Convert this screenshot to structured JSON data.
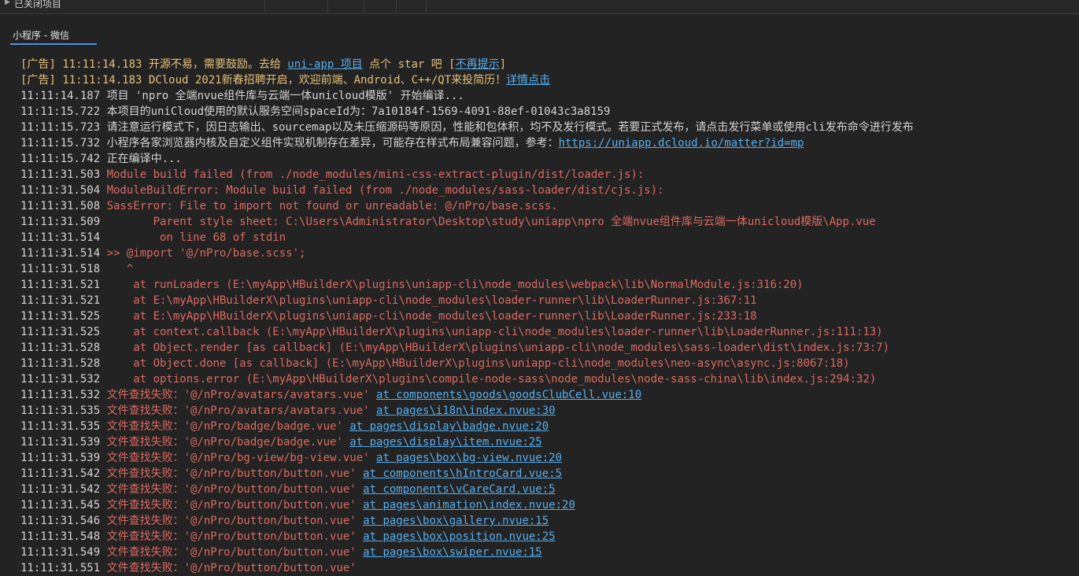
{
  "topbar": {
    "closed_projects_label": "已关闭项目"
  },
  "console": {
    "tab_label": "小程序 - 微信",
    "lines": [
      {
        "type": "ad",
        "segments": [
          {
            "text": "[广告] 11:11:14.183 开源不易，需要鼓励。去给 ",
            "kind": "ad"
          },
          {
            "text": "uni-app 项目",
            "kind": "link"
          },
          {
            "text": " 点个 star 吧 [",
            "kind": "ad"
          },
          {
            "text": "不再提示",
            "kind": "link"
          },
          {
            "text": "]",
            "kind": "ad"
          }
        ]
      },
      {
        "type": "ad",
        "segments": [
          {
            "text": "[广告] 11:11:14.183 DCloud 2021新春招聘开启，欢迎前端、Android、C++/QT来投简历！",
            "kind": "ad"
          },
          {
            "text": "详情点击",
            "kind": "link"
          }
        ]
      },
      {
        "type": "info",
        "segments": [
          {
            "text": "11:11:14.187 ",
            "kind": "ts"
          },
          {
            "text": "项目 'npro 全端nvue组件库与云端一体unicloud模版' 开始编译...",
            "kind": "info"
          }
        ]
      },
      {
        "type": "info",
        "segments": [
          {
            "text": "11:11:15.722 ",
            "kind": "ts"
          },
          {
            "text": "本项目的uniCloud使用的默认服务空间spaceId为：7a10184f-1569-4091-88ef-01043c3a8159",
            "kind": "info"
          }
        ]
      },
      {
        "type": "info",
        "segments": [
          {
            "text": "11:11:15.723 ",
            "kind": "ts"
          },
          {
            "text": "请注意运行模式下，因日志输出、sourcemap以及未压缩源码等原因，性能和包体积，均不及发行模式。若要正式发布，请点击发行菜单或使用cli发布命令进行发布",
            "kind": "info"
          }
        ]
      },
      {
        "type": "info",
        "segments": [
          {
            "text": "11:11:15.732 ",
            "kind": "ts"
          },
          {
            "text": "小程序各家浏览器内核及自定义组件实现机制存在差异，可能存在样式布局兼容问题，参考：",
            "kind": "info"
          },
          {
            "text": "https://uniapp.dcloud.io/matter?id=mp",
            "kind": "link"
          }
        ]
      },
      {
        "type": "info",
        "segments": [
          {
            "text": "11:11:15.742 ",
            "kind": "ts"
          },
          {
            "text": "正在编译中...",
            "kind": "info"
          }
        ]
      },
      {
        "type": "err",
        "segments": [
          {
            "text": "11:11:31.503 ",
            "kind": "ts"
          },
          {
            "text": "Module build failed (from ./node_modules/mini-css-extract-plugin/dist/loader.js):",
            "kind": "err"
          }
        ]
      },
      {
        "type": "err",
        "segments": [
          {
            "text": "11:11:31.504 ",
            "kind": "ts"
          },
          {
            "text": "ModuleBuildError: Module build failed (from ./node_modules/sass-loader/dist/cjs.js):",
            "kind": "err"
          }
        ]
      },
      {
        "type": "err",
        "segments": [
          {
            "text": "11:11:31.508 ",
            "kind": "ts"
          },
          {
            "text": "SassError: File to import not found or unreadable: @/nPro/base.scss.",
            "kind": "err"
          }
        ]
      },
      {
        "type": "err",
        "segments": [
          {
            "text": "11:11:31.509 ",
            "kind": "ts"
          },
          {
            "text": "       Parent style sheet: C:\\Users\\Administrator\\Desktop\\study\\uniapp\\npro 全端nvue组件库与云端一体unicloud模版\\App.vue",
            "kind": "err"
          }
        ]
      },
      {
        "type": "err",
        "segments": [
          {
            "text": "11:11:31.514 ",
            "kind": "ts"
          },
          {
            "text": "        on line 68 of stdin",
            "kind": "err"
          }
        ]
      },
      {
        "type": "err",
        "segments": [
          {
            "text": "11:11:31.514 ",
            "kind": "ts"
          },
          {
            "text": ">> @import '@/nPro/base.scss';",
            "kind": "err"
          }
        ]
      },
      {
        "type": "err",
        "segments": [
          {
            "text": "11:11:31.518 ",
            "kind": "ts"
          },
          {
            "text": "   ^",
            "kind": "err"
          }
        ]
      },
      {
        "type": "err",
        "segments": [
          {
            "text": "11:11:31.521 ",
            "kind": "ts"
          },
          {
            "text": "    at runLoaders (E:\\myApp\\HBuilderX\\plugins\\uniapp-cli\\node_modules\\webpack\\lib\\NormalModule.js:316:20)",
            "kind": "err"
          }
        ]
      },
      {
        "type": "err",
        "segments": [
          {
            "text": "11:11:31.521 ",
            "kind": "ts"
          },
          {
            "text": "    at E:\\myApp\\HBuilderX\\plugins\\uniapp-cli\\node_modules\\loader-runner\\lib\\LoaderRunner.js:367:11",
            "kind": "err"
          }
        ]
      },
      {
        "type": "err",
        "segments": [
          {
            "text": "11:11:31.525 ",
            "kind": "ts"
          },
          {
            "text": "    at E:\\myApp\\HBuilderX\\plugins\\uniapp-cli\\node_modules\\loader-runner\\lib\\LoaderRunner.js:233:18",
            "kind": "err"
          }
        ]
      },
      {
        "type": "err",
        "segments": [
          {
            "text": "11:11:31.525 ",
            "kind": "ts"
          },
          {
            "text": "    at context.callback (E:\\myApp\\HBuilderX\\plugins\\uniapp-cli\\node_modules\\loader-runner\\lib\\LoaderRunner.js:111:13)",
            "kind": "err"
          }
        ]
      },
      {
        "type": "err",
        "segments": [
          {
            "text": "11:11:31.528 ",
            "kind": "ts"
          },
          {
            "text": "    at Object.render [as callback] (E:\\myApp\\HBuilderX\\plugins\\uniapp-cli\\node_modules\\sass-loader\\dist\\index.js:73:7)",
            "kind": "err"
          }
        ]
      },
      {
        "type": "err",
        "segments": [
          {
            "text": "11:11:31.528 ",
            "kind": "ts"
          },
          {
            "text": "    at Object.done [as callback] (E:\\myApp\\HBuilderX\\plugins\\uniapp-cli\\node_modules\\neo-async\\async.js:8067:18)",
            "kind": "err"
          }
        ]
      },
      {
        "type": "err",
        "segments": [
          {
            "text": "11:11:31.532 ",
            "kind": "ts"
          },
          {
            "text": "    at options.error (E:\\myApp\\HBuilderX\\plugins\\compile-node-sass\\node_modules\\node-sass-china\\lib\\index.js:294:32)",
            "kind": "err"
          }
        ]
      },
      {
        "type": "err",
        "segments": [
          {
            "text": "11:11:31.532 ",
            "kind": "ts"
          },
          {
            "text": "文件查找失败：'@/nPro/avatars/avatars.vue' ",
            "kind": "err"
          },
          {
            "text": "at components\\goods\\goodsClubCell.vue:10",
            "kind": "link"
          }
        ]
      },
      {
        "type": "err",
        "segments": [
          {
            "text": "11:11:31.535 ",
            "kind": "ts"
          },
          {
            "text": "文件查找失败：'@/nPro/avatars/avatars.vue' ",
            "kind": "err"
          },
          {
            "text": "at pages\\i18n\\index.nvue:30",
            "kind": "link"
          }
        ]
      },
      {
        "type": "err",
        "segments": [
          {
            "text": "11:11:31.535 ",
            "kind": "ts"
          },
          {
            "text": "文件查找失败：'@/nPro/badge/badge.vue' ",
            "kind": "err"
          },
          {
            "text": "at pages\\display\\badge.nvue:20",
            "kind": "link"
          }
        ]
      },
      {
        "type": "err",
        "segments": [
          {
            "text": "11:11:31.539 ",
            "kind": "ts"
          },
          {
            "text": "文件查找失败：'@/nPro/badge/badge.vue' ",
            "kind": "err"
          },
          {
            "text": "at pages\\display\\item.nvue:25",
            "kind": "link"
          }
        ]
      },
      {
        "type": "err",
        "segments": [
          {
            "text": "11:11:31.539 ",
            "kind": "ts"
          },
          {
            "text": "文件查找失败：'@/nPro/bg-view/bg-view.vue' ",
            "kind": "err"
          },
          {
            "text": "at pages\\box\\bg-view.nvue:20",
            "kind": "link"
          }
        ]
      },
      {
        "type": "err",
        "segments": [
          {
            "text": "11:11:31.542 ",
            "kind": "ts"
          },
          {
            "text": "文件查找失败：'@/nPro/button/button.vue' ",
            "kind": "err"
          },
          {
            "text": "at components\\hIntroCard.vue:5",
            "kind": "link"
          }
        ]
      },
      {
        "type": "err",
        "segments": [
          {
            "text": "11:11:31.542 ",
            "kind": "ts"
          },
          {
            "text": "文件查找失败：'@/nPro/button/button.vue' ",
            "kind": "err"
          },
          {
            "text": "at components\\vCareCard.vue:5",
            "kind": "link"
          }
        ]
      },
      {
        "type": "err",
        "segments": [
          {
            "text": "11:11:31.545 ",
            "kind": "ts"
          },
          {
            "text": "文件查找失败：'@/nPro/button/button.vue' ",
            "kind": "err"
          },
          {
            "text": "at pages\\animation\\index.nvue:20",
            "kind": "link"
          }
        ]
      },
      {
        "type": "err",
        "segments": [
          {
            "text": "11:11:31.546 ",
            "kind": "ts"
          },
          {
            "text": "文件查找失败：'@/nPro/button/button.vue' ",
            "kind": "err"
          },
          {
            "text": "at pages\\box\\gallery.nvue:15",
            "kind": "link"
          }
        ]
      },
      {
        "type": "err",
        "segments": [
          {
            "text": "11:11:31.548 ",
            "kind": "ts"
          },
          {
            "text": "文件查找失败：'@/nPro/button/button.vue' ",
            "kind": "err"
          },
          {
            "text": "at pages\\box\\position.nvue:25",
            "kind": "link"
          }
        ]
      },
      {
        "type": "err",
        "segments": [
          {
            "text": "11:11:31.549 ",
            "kind": "ts"
          },
          {
            "text": "文件查找失败：'@/nPro/button/button.vue' ",
            "kind": "err"
          },
          {
            "text": "at pages\\box\\swiper.nvue:15",
            "kind": "link"
          }
        ]
      },
      {
        "type": "err",
        "segments": [
          {
            "text": "11:11:31.551 ",
            "kind": "ts"
          },
          {
            "text": "文件查找失败：'@/nPro/button/button.vue' ",
            "kind": "err"
          }
        ]
      }
    ]
  },
  "colors": {
    "background": "#232323",
    "timestamp": "#d4d4d4",
    "ad": "#e5c07b",
    "error": "#dc6a62",
    "link": "#56aef0",
    "tab_underline": "#4e8fd9"
  }
}
